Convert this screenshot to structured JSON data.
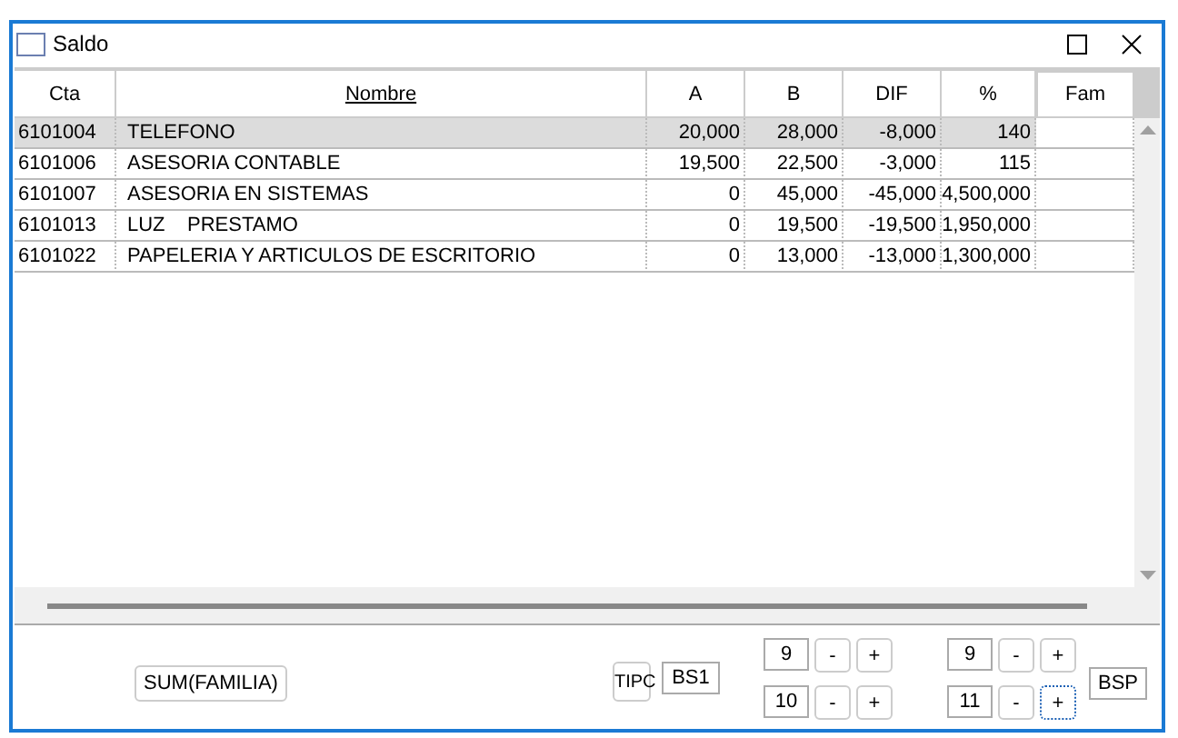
{
  "window": {
    "title": "Saldo"
  },
  "table": {
    "columns": [
      {
        "label": "Cta",
        "sorted": false
      },
      {
        "label": "Nombre",
        "sorted": true
      },
      {
        "label": "A",
        "sorted": false
      },
      {
        "label": "B",
        "sorted": false
      },
      {
        "label": "DIF",
        "sorted": false
      },
      {
        "label": "%",
        "sorted": false
      },
      {
        "label": "Fam",
        "sorted": false
      }
    ],
    "rows": [
      {
        "selected": true,
        "cells": [
          "6101004",
          "TELEFONO",
          "20,000",
          "28,000",
          "-8,000",
          "140",
          ""
        ]
      },
      {
        "selected": false,
        "cells": [
          "6101006",
          "ASESORIA CONTABLE",
          "19,500",
          "22,500",
          "-3,000",
          "115",
          ""
        ]
      },
      {
        "selected": false,
        "cells": [
          "6101007",
          "ASESORIA EN SISTEMAS",
          "0",
          "45,000",
          "-45,000",
          "4,500,000",
          ""
        ]
      },
      {
        "selected": false,
        "cells": [
          "6101013",
          "LUZ    PRESTAMO",
          "0",
          "19,500",
          "-19,500",
          "1,950,000",
          ""
        ]
      },
      {
        "selected": false,
        "cells": [
          "6101022",
          "PAPELERIA Y ARTICULOS DE ESCRITORIO",
          "0",
          "13,000",
          "-13,000",
          "1,300,000",
          ""
        ]
      }
    ]
  },
  "sum_button": "SUM(FAMILIA)",
  "tipc_button": "TIPC",
  "bs1_field": "BS1",
  "spinner_groups": [
    [
      {
        "value": "9",
        "minus": "-",
        "plus": "+",
        "plus_focused": false
      },
      {
        "value": "10",
        "minus": "-",
        "plus": "+",
        "plus_focused": false
      }
    ],
    [
      {
        "value": "9",
        "minus": "-",
        "plus": "+",
        "plus_focused": false
      },
      {
        "value": "11",
        "minus": "-",
        "plus": "+",
        "plus_focused": true
      }
    ]
  ],
  "bsp_field": "BSP"
}
